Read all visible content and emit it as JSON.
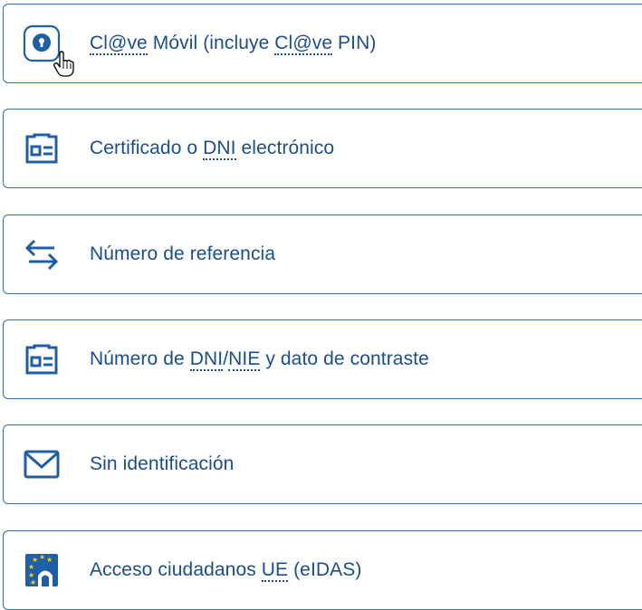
{
  "options": [
    {
      "icon": "mobile-lock-icon",
      "parts": [
        {
          "abbr": true,
          "text": "Cl@ve"
        },
        {
          "abbr": false,
          "text": " Móvil (incluye "
        },
        {
          "abbr": true,
          "text": "Cl@ve"
        },
        {
          "abbr": false,
          "text": " PIN)"
        }
      ]
    },
    {
      "icon": "id-card-icon",
      "parts": [
        {
          "abbr": false,
          "text": "Certificado o "
        },
        {
          "abbr": true,
          "text": "DNI"
        },
        {
          "abbr": false,
          "text": " electrónico"
        }
      ]
    },
    {
      "icon": "arrows-exchange-icon",
      "parts": [
        {
          "abbr": false,
          "text": "Número de referencia"
        }
      ]
    },
    {
      "icon": "id-card-icon",
      "parts": [
        {
          "abbr": false,
          "text": "Número de "
        },
        {
          "abbr": true,
          "text": "DNI"
        },
        {
          "abbr": false,
          "text": "/"
        },
        {
          "abbr": true,
          "text": "NIE"
        },
        {
          "abbr": false,
          "text": " y dato de contraste"
        }
      ]
    },
    {
      "icon": "envelope-icon",
      "parts": [
        {
          "abbr": false,
          "text": "Sin identificación"
        }
      ]
    },
    {
      "icon": "eu-flag-icon",
      "parts": [
        {
          "abbr": false,
          "text": "Acceso ciudadanos "
        },
        {
          "abbr": true,
          "text": "UE"
        },
        {
          "abbr": false,
          "text": " (eIDAS)"
        }
      ]
    }
  ],
  "colors": {
    "border": "#2f6fb5",
    "text": "#1a4e8c",
    "icon": "#1f5fa8",
    "eu_star": "#ffcc00"
  }
}
